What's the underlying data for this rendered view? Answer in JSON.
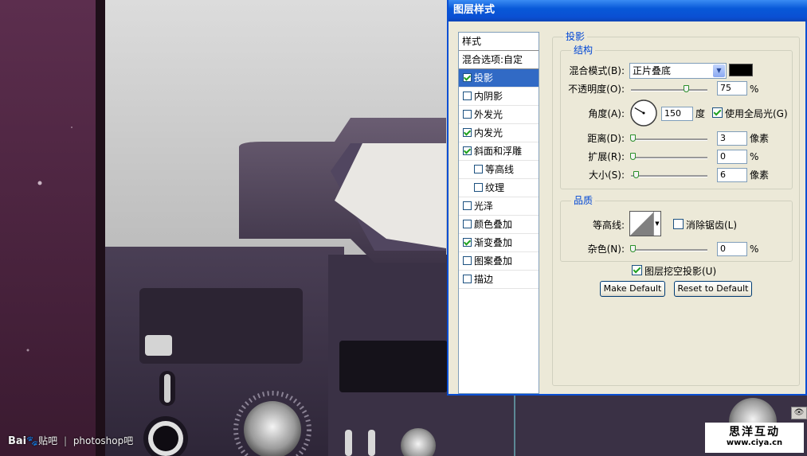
{
  "dialog": {
    "title": "图层样式",
    "left_panel": {
      "header": "样式",
      "blending_options": "混合选项:自定",
      "items": [
        {
          "label": "投影",
          "checked": true,
          "selected": true,
          "indent": false
        },
        {
          "label": "内阴影",
          "checked": false,
          "selected": false,
          "indent": false
        },
        {
          "label": "外发光",
          "checked": false,
          "selected": false,
          "indent": false
        },
        {
          "label": "内发光",
          "checked": true,
          "selected": false,
          "indent": false
        },
        {
          "label": "斜面和浮雕",
          "checked": true,
          "selected": false,
          "indent": false
        },
        {
          "label": "等高线",
          "checked": false,
          "selected": false,
          "indent": true
        },
        {
          "label": "纹理",
          "checked": false,
          "selected": false,
          "indent": true
        },
        {
          "label": "光泽",
          "checked": false,
          "selected": false,
          "indent": false
        },
        {
          "label": "颜色叠加",
          "checked": false,
          "selected": false,
          "indent": false
        },
        {
          "label": "渐变叠加",
          "checked": true,
          "selected": false,
          "indent": false
        },
        {
          "label": "图案叠加",
          "checked": false,
          "selected": false,
          "indent": false
        },
        {
          "label": "描边",
          "checked": false,
          "selected": false,
          "indent": false
        }
      ]
    },
    "drop_shadow": {
      "title": "投影",
      "structure": {
        "title": "结构",
        "blend_mode_label": "混合模式(B):",
        "blend_mode_value": "正片叠底",
        "shadow_color": "#000000",
        "opacity_label": "不透明度(O):",
        "opacity_value": "75",
        "opacity_fraction": 0.75,
        "opacity_unit": "%",
        "angle_label": "角度(A):",
        "angle_value": "150",
        "angle_degrees": 150,
        "angle_unit": "度",
        "global_light_label": "使用全局光(G)",
        "global_light_checked": true,
        "distance_label": "距离(D):",
        "distance_value": "3",
        "distance_fraction": 0.0,
        "distance_unit": "像素",
        "spread_label": "扩展(R):",
        "spread_value": "0",
        "spread_fraction": 0.0,
        "spread_unit": "%",
        "size_label": "大小(S):",
        "size_value": "6",
        "size_fraction": 0.04,
        "size_unit": "像素"
      },
      "quality": {
        "title": "品质",
        "contour_label": "等高线:",
        "anti_alias_label": "消除锯齿(L)",
        "anti_alias_checked": false,
        "noise_label": "杂色(N):",
        "noise_value": "0",
        "noise_fraction": 0.0,
        "noise_unit": "%"
      },
      "knockout_label": "图层挖空投影(U)",
      "knockout_checked": true,
      "make_default": "Make Default",
      "reset_default": "Reset to Default"
    }
  },
  "watermark": {
    "logo": "Bai",
    "logo_tail": "贴吧",
    "separator": "|",
    "text": "photoshop吧"
  },
  "brand": {
    "line1": "思洋互动",
    "line2": "www.ciya.cn"
  },
  "colors": {
    "title_bar": "#0a4fd3",
    "selection": "#316ac5",
    "panel_bg": "#ece9d8",
    "group_title": "#0046d5"
  }
}
